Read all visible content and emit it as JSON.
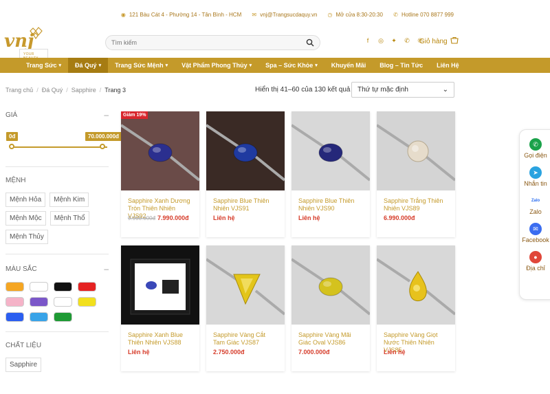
{
  "topbar": {
    "address": "121 Bàu Cát 4 - Phường 14 - Tân Bình - HCM",
    "email": "vnj@Trangsucdaquy.vn",
    "hours": "Mở cửa 8:30-20:30",
    "hotline": "Hotline 070 8877 999"
  },
  "logo": {
    "mark": "vnj",
    "tagline": "YOUR BEAUTY"
  },
  "search": {
    "placeholder": "Tìm kiếm"
  },
  "cart": {
    "label": "Giỏ hàng"
  },
  "nav": {
    "items": [
      {
        "label": "Trang Sức",
        "chev": "▾"
      },
      {
        "label": "Đá Quý",
        "chev": "▾"
      },
      {
        "label": "Trang Sức Mệnh",
        "chev": "▾"
      },
      {
        "label": "Vật Phẩm Phong Thủy",
        "chev": "▾"
      },
      {
        "label": "Spa – Sức Khỏe",
        "chev": "▾"
      },
      {
        "label": "Khuyến Mãi",
        "chev": ""
      },
      {
        "label": "Blog – Tin Tức",
        "chev": ""
      },
      {
        "label": "Liên Hệ",
        "chev": ""
      }
    ]
  },
  "breadcrumb": [
    "Trang chủ",
    "Đá Quý",
    "Sapphire",
    "Trang 3"
  ],
  "results": "Hiển thị 41–60 của 130 kết quả",
  "sort": {
    "selected": "Thứ tự mặc định"
  },
  "filters": {
    "price": {
      "title": "GIÁ",
      "min": "0đ",
      "max": "70.000.000đ"
    },
    "menh": {
      "title": "MỆNH",
      "tags": [
        "Mệnh Hỏa",
        "Mệnh Kim",
        "Mệnh Mộc",
        "Mệnh Thổ",
        "Mệnh Thủy"
      ]
    },
    "color": {
      "title": "MÀU SẮC",
      "swatches": [
        "#f5a623",
        "#ffffff",
        "#111111",
        "#e52222",
        "#f5b3c8",
        "#7b57c9",
        "#ffffff",
        "#f2e01d",
        "#2b5ef0",
        "#38a3e8",
        "#1e9a34"
      ]
    },
    "material": {
      "title": "CHẤT LIỆU",
      "tags": [
        "Sapphire"
      ]
    }
  },
  "products": [
    {
      "name": "Sapphire Xanh Dương Tròn Thiên Nhiên VJS92",
      "old_price": "9.900.000đ",
      "price": "7.990.000đ",
      "sale": "Giảm 19%",
      "gem": "#2b2f8f",
      "bg": "#6a4b48",
      "shape": "oval"
    },
    {
      "name": "Sapphire Blue Thiên Nhiên VJS91",
      "old_price": "",
      "price": "Liên hệ",
      "sale": "",
      "gem": "#1f3aa0",
      "bg": "#3a2a25",
      "shape": "oval"
    },
    {
      "name": "Sapphire Blue Thiên Nhiên VJS90",
      "old_price": "",
      "price": "Liên hệ",
      "sale": "",
      "gem": "#25287a",
      "bg": "#d8d8d8",
      "shape": "oval"
    },
    {
      "name": "Sapphire Trắng Thiên Nhiên VJS89",
      "old_price": "",
      "price": "6.990.000đ",
      "sale": "",
      "gem": "#e6dccb",
      "bg": "#d4d4d4",
      "shape": "round"
    },
    {
      "name": "Sapphire Xanh Blue Thiên Nhiên VJS88",
      "old_price": "",
      "price": "Liên hệ",
      "sale": "",
      "gem": "#3a48b8",
      "bg": "#111111",
      "shape": "card"
    },
    {
      "name": "Sapphire Vàng Cắt Tam Giác VJS87",
      "old_price": "",
      "price": "2.750.000đ",
      "sale": "",
      "gem": "#e3c51a",
      "bg": "#d8d8d8",
      "shape": "triangle"
    },
    {
      "name": "Sapphire Vàng Mãi Giác Oval VJS86",
      "old_price": "",
      "price": "7.000.000đ",
      "sale": "",
      "gem": "#d4c21e",
      "bg": "#d6d6d6",
      "shape": "oval"
    },
    {
      "name": "Sapphire Vàng Giọt Nước Thiên Nhiên VJS85",
      "old_price": "",
      "price": "Liên hệ",
      "sale": "",
      "gem": "#e7c21d",
      "bg": "#d8d8d8",
      "shape": "drop"
    }
  ],
  "contact_panel": [
    {
      "label": "Gọi điện",
      "icon": "phone-icon",
      "color": "#1aa24a",
      "glyph": "✆"
    },
    {
      "label": "Nhắn tin",
      "icon": "telegram-icon",
      "color": "#2aa3e0",
      "glyph": "➤"
    },
    {
      "label": "Zalo",
      "icon": "zalo-icon",
      "color": "#ffffff",
      "glyph": "Zalo"
    },
    {
      "label": "Facebook",
      "icon": "messenger-icon",
      "color": "#3b6df0",
      "glyph": "✉"
    },
    {
      "label": "Địa chỉ",
      "icon": "map-pin-icon",
      "color": "#e0473a",
      "glyph": "●"
    }
  ]
}
